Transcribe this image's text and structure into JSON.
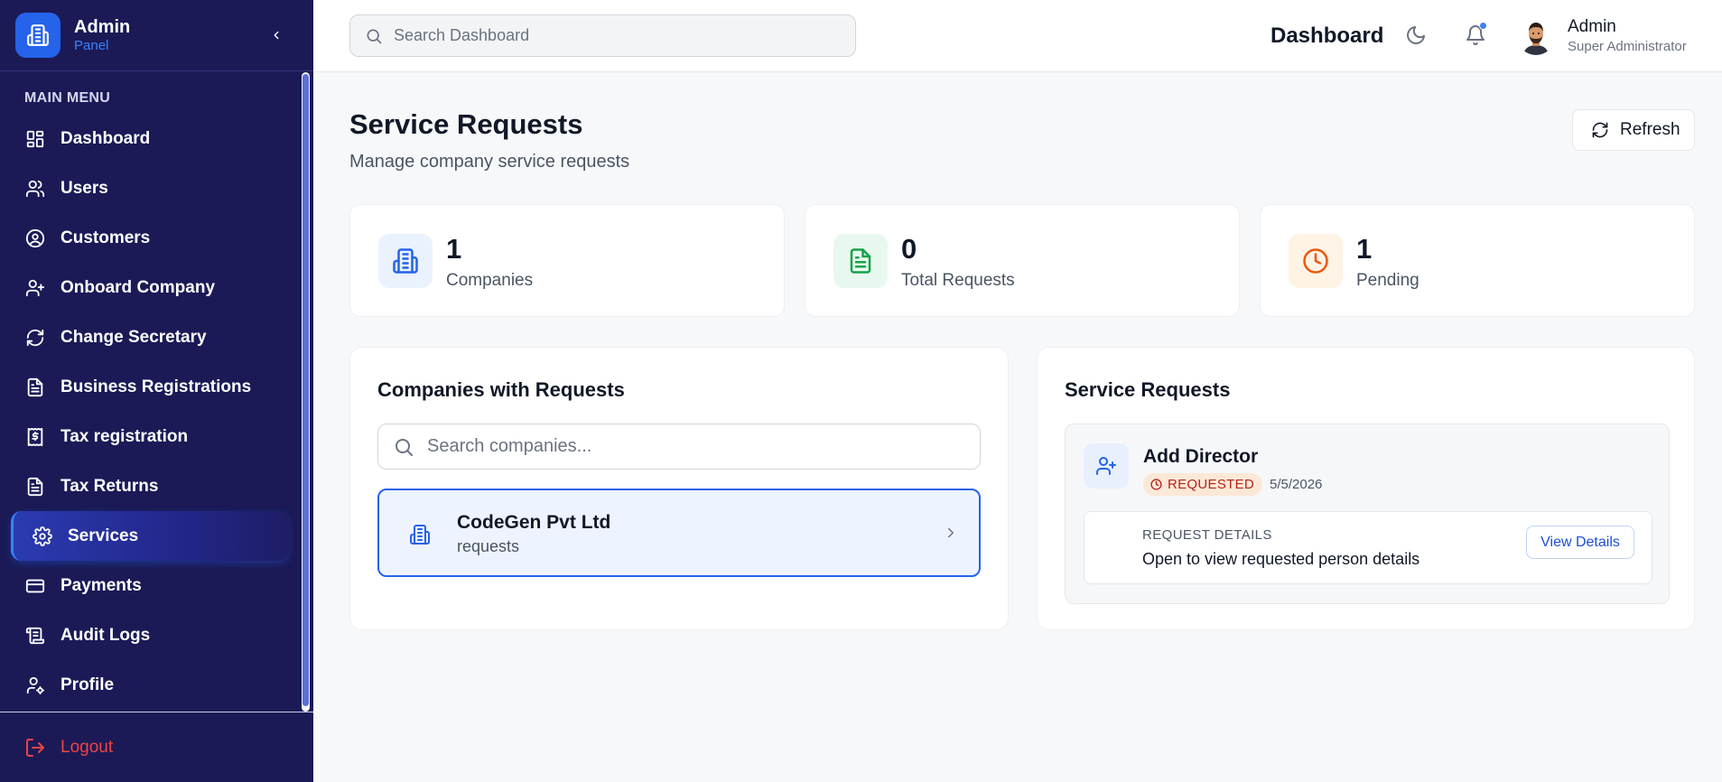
{
  "sidebar": {
    "brand_title": "Admin",
    "brand_subtitle": "Panel",
    "menu_title": "MAIN MENU",
    "items": [
      {
        "label": "Dashboard",
        "icon": "dashboard-icon"
      },
      {
        "label": "Users",
        "icon": "users-icon"
      },
      {
        "label": "Customers",
        "icon": "user-circle-icon"
      },
      {
        "label": "Onboard Company",
        "icon": "user-plus-icon"
      },
      {
        "label": "Change Secretary",
        "icon": "refresh-icon"
      },
      {
        "label": "Business Registrations",
        "icon": "document-icon"
      },
      {
        "label": "Tax registration",
        "icon": "dollar-receipt-icon"
      },
      {
        "label": "Tax Returns",
        "icon": "document-icon"
      },
      {
        "label": "Services",
        "icon": "gear-icon",
        "active": true
      },
      {
        "label": "Payments",
        "icon": "credit-card-icon"
      },
      {
        "label": "Audit Logs",
        "icon": "scroll-icon"
      },
      {
        "label": "Profile",
        "icon": "user-gear-icon"
      }
    ],
    "logout_label": "Logout"
  },
  "topbar": {
    "search_placeholder": "Search Dashboard",
    "title": "Dashboard",
    "user_name": "Admin",
    "user_role": "Super Administrator"
  },
  "page": {
    "title": "Service Requests",
    "subtitle": "Manage company service requests",
    "refresh_label": "Refresh"
  },
  "stats": [
    {
      "value": "1",
      "label": "Companies",
      "icon": "building-icon",
      "bg": "#eaf2fe",
      "fg": "#2563eb"
    },
    {
      "value": "0",
      "label": "Total Requests",
      "icon": "document-icon",
      "bg": "#e8f8ee",
      "fg": "#16a34a"
    },
    {
      "value": "1",
      "label": "Pending",
      "icon": "clock-icon",
      "bg": "#fff3e6",
      "fg": "#ea580c"
    }
  ],
  "companies_panel": {
    "title": "Companies with Requests",
    "search_placeholder": "Search companies...",
    "companies": [
      {
        "name": "CodeGen Pvt Ltd",
        "sub": "requests"
      }
    ]
  },
  "requests_panel": {
    "title": "Service Requests",
    "requests": [
      {
        "title": "Add Director",
        "status": "REQUESTED",
        "date": "5/5/2026",
        "details_label": "REQUEST DETAILS",
        "details_text": "Open to view requested person details",
        "view_label": "View Details"
      }
    ]
  },
  "colors": {
    "sidebar_bg": "#1b1a57",
    "accent": "#2563eb",
    "logout": "#ef4444"
  }
}
